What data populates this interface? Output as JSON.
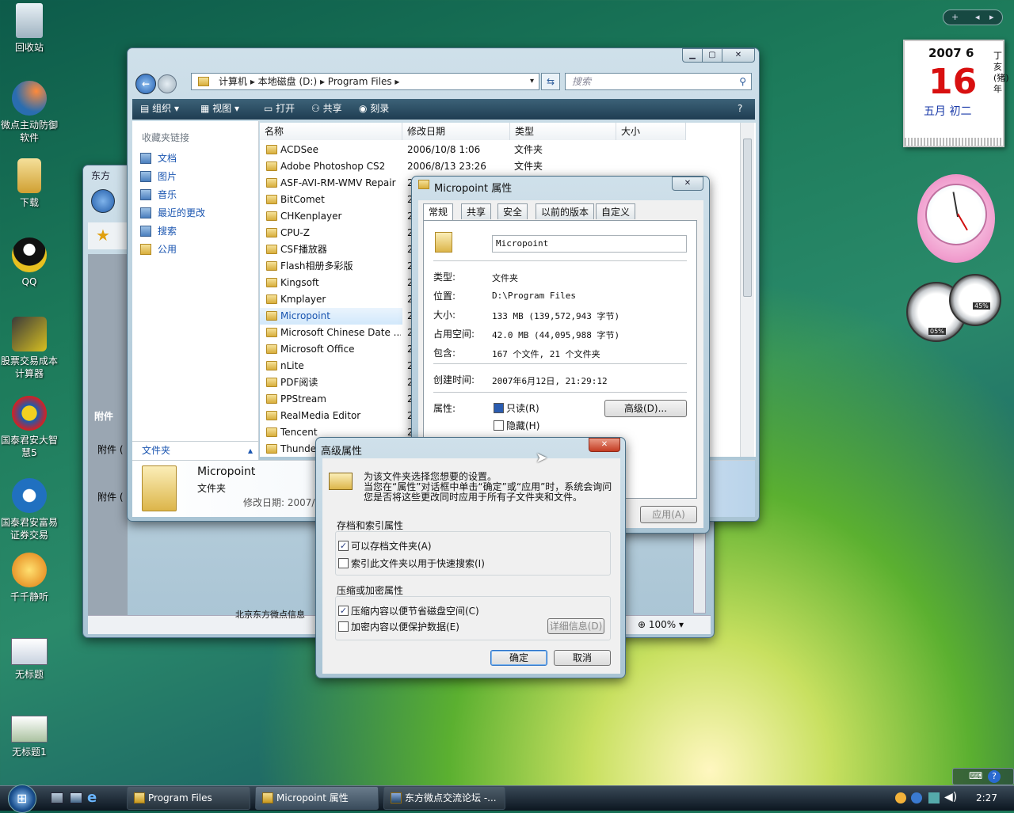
{
  "desktop": {
    "icons": [
      "回收站",
      "微点主动防御软件",
      "下载",
      "QQ",
      "股票交易成本计算器",
      "国泰君安大智慧5",
      "国泰君安富易证券交易",
      "千千静听",
      "无标题",
      "无标题1"
    ]
  },
  "calendar": {
    "year_month": "2007 6",
    "day": "16",
    "lunar": "五月 初二",
    "side": "丁亥(猪)年"
  },
  "gauges": {
    "cpu": "05%",
    "mem": "45%"
  },
  "explorer": {
    "breadcrumb": [
      "计算机",
      "本地磁盘 (D:)",
      "Program Files"
    ],
    "search_placeholder": "搜索",
    "toolbar": [
      "组织",
      "视图",
      "打开",
      "共享",
      "刻录"
    ],
    "fav_header": "收藏夹链接",
    "fav_links": [
      "文档",
      "图片",
      "音乐",
      "最近的更改",
      "搜索",
      "公用"
    ],
    "folders_label": "文件夹",
    "columns": [
      "名称",
      "修改日期",
      "类型",
      "大小"
    ],
    "rows": [
      {
        "name": "ACDSee",
        "date": "2006/10/8 1:06",
        "type": "文件夹"
      },
      {
        "name": "Adobe Photoshop CS2",
        "date": "2006/8/13 23:26",
        "type": "文件夹"
      },
      {
        "name": "ASF-AVI-RM-WMV Repair",
        "date": "2",
        "type": ""
      },
      {
        "name": "BitComet",
        "date": "2",
        "type": ""
      },
      {
        "name": "CHKenplayer",
        "date": "2",
        "type": ""
      },
      {
        "name": "CPU-Z",
        "date": "2",
        "type": ""
      },
      {
        "name": "CSF播放器",
        "date": "2",
        "type": ""
      },
      {
        "name": "Flash相册多彩版",
        "date": "2",
        "type": ""
      },
      {
        "name": "Kingsoft",
        "date": "2",
        "type": ""
      },
      {
        "name": "Kmplayer",
        "date": "2",
        "type": ""
      },
      {
        "name": "Micropoint",
        "date": "2",
        "type": ""
      },
      {
        "name": "Microsoft Chinese Date ...",
        "date": "2",
        "type": ""
      },
      {
        "name": "Microsoft Office",
        "date": "2",
        "type": ""
      },
      {
        "name": "nLite",
        "date": "2",
        "type": ""
      },
      {
        "name": "PDF阅读",
        "date": "2",
        "type": ""
      },
      {
        "name": "PPStream",
        "date": "2",
        "type": ""
      },
      {
        "name": "RealMedia Editor",
        "date": "2",
        "type": ""
      },
      {
        "name": "Tencent",
        "date": "2",
        "type": ""
      },
      {
        "name": "Thunde",
        "date": "2",
        "type": ""
      }
    ],
    "details": {
      "name": "Micropoint",
      "type": "文件夹",
      "modified": "修改日期: 2007/"
    }
  },
  "browser": {
    "title": "东方",
    "fav_area": "附件",
    "rows": [
      "附件 (",
      "附件 ("
    ],
    "status": "北京东方微点信息",
    "zoom": "100%"
  },
  "properties": {
    "title": "Micropoint 属性",
    "tabs": [
      "常规",
      "共享",
      "安全",
      "以前的版本",
      "自定义"
    ],
    "name_value": "Micropoint",
    "fields": [
      {
        "label": "类型:",
        "value": "文件夹"
      },
      {
        "label": "位置:",
        "value": "D:\\Program Files"
      },
      {
        "label": "大小:",
        "value": "133 MB (139,572,943 字节)"
      },
      {
        "label": "占用空间:",
        "value": "42.0 MB (44,095,988 字节)"
      },
      {
        "label": "包含:",
        "value": "167 个文件, 21 个文件夹"
      }
    ],
    "created_label": "创建时间:",
    "created_value": "2007年6月12日, 21:29:12",
    "attr_label": "属性:",
    "readonly": "只读(R)",
    "hidden": "隐藏(H)",
    "advanced_btn": "高级(D)...",
    "apply_btn": "应用(A)"
  },
  "advanced": {
    "title": "高级属性",
    "desc1": "为该文件夹选择您想要的设置。",
    "desc2": "当您在“属性”对话框中单击“确定”或“应用”时，系统会询问您是否将这些更改同时应用于所有子文件夹和文件。",
    "group1": "存档和索引属性",
    "opt1": "可以存档文件夹(A)",
    "opt2": "索引此文件夹以用于快速搜索(I)",
    "group2": "压缩或加密属性",
    "opt3": "压缩内容以便节省磁盘空间(C)",
    "opt4": "加密内容以便保护数据(E)",
    "details_btn": "详细信息(D)",
    "ok": "确定",
    "cancel": "取消"
  },
  "taskbar": {
    "tasks": [
      "Program Files",
      "Micropoint 属性",
      "东方微点交流论坛 -..."
    ],
    "clock": "2:27"
  }
}
